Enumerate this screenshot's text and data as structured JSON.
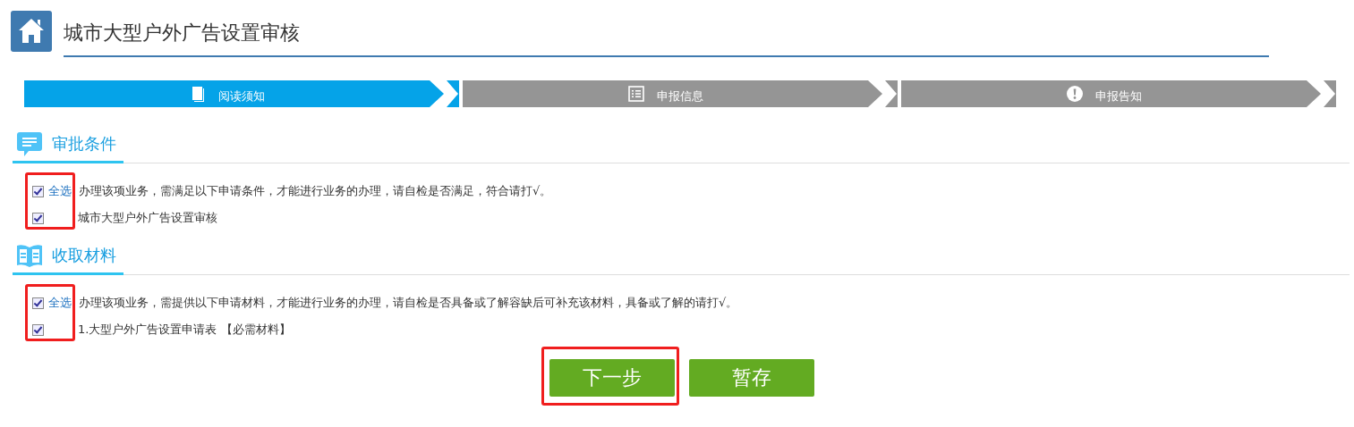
{
  "page_title": "城市大型户外广告设置审核",
  "steps": [
    {
      "label": "阅读须知",
      "selected": true
    },
    {
      "label": "申报信息",
      "selected": false
    },
    {
      "label": "申报告知",
      "selected": false
    }
  ],
  "sections": [
    {
      "title": "审批条件",
      "highlighted": true,
      "select_all": {
        "label": "全选",
        "checked": true
      },
      "instruction": "办理该项业务，需满足以下申请条件，才能进行业务的办理，请自检是否满足，符合请打√。",
      "items": [
        {
          "label": "城市大型户外广告设置审核",
          "checked": true
        }
      ]
    },
    {
      "title": "收取材料",
      "highlighted": true,
      "select_all": {
        "label": "全选",
        "checked": true
      },
      "instruction": "办理该项业务，需提供以下申请材料，才能进行业务的办理，请自检是否具备或了解容缺后可补充该材料，具备或了解的请打√。",
      "items": [
        {
          "label": "1.大型户外广告设置申请表 【必需材料】",
          "checked": true
        }
      ]
    }
  ],
  "buttons": [
    {
      "label": "下一步",
      "highlighted": true
    },
    {
      "label": "暂存",
      "highlighted": false
    }
  ]
}
